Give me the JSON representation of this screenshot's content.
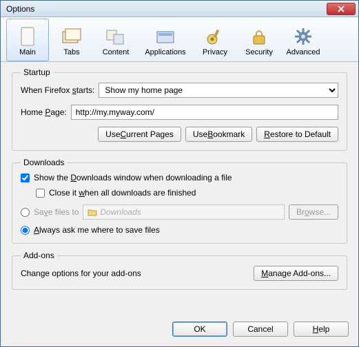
{
  "window": {
    "title": "Options"
  },
  "tabs": {
    "main": "Main",
    "tabs": "Tabs",
    "content": "Content",
    "applications": "Applications",
    "privacy": "Privacy",
    "security": "Security",
    "advanced": "Advanced"
  },
  "startup": {
    "legend": "Startup",
    "when_label_pre": "When Firefox ",
    "when_label_u": "s",
    "when_label_post": "tarts:",
    "when_value": "Show my home page",
    "home_label_pre": "Home ",
    "home_label_u": "P",
    "home_label_post": "age:",
    "home_value": "http://my.myway.com/",
    "btn_current_pre": "Use ",
    "btn_current_u": "C",
    "btn_current_post": "urrent Pages",
    "btn_bookmark_pre": "Use ",
    "btn_bookmark_u": "B",
    "btn_bookmark_post": "ookmark",
    "btn_restore_pre": "",
    "btn_restore_u": "R",
    "btn_restore_post": "estore to Default"
  },
  "downloads": {
    "legend": "Downloads",
    "show_pre": "Show the ",
    "show_u": "D",
    "show_post": "ownloads window when downloading a file",
    "close_pre": "Close it ",
    "close_u": "w",
    "close_post": "hen all downloads are finished",
    "save_pre": "Sa",
    "save_u": "v",
    "save_post": "e files to",
    "save_placeholder": "Downloads",
    "browse_pre": "Br",
    "browse_u": "o",
    "browse_post": "wse...",
    "always_pre": "",
    "always_u": "A",
    "always_post": "lways ask me where to save files"
  },
  "addons": {
    "legend": "Add-ons",
    "desc": "Change options for your add-ons",
    "btn_pre": "",
    "btn_u": "M",
    "btn_post": "anage Add-ons..."
  },
  "buttons": {
    "ok": "OK",
    "cancel": "Cancel",
    "help_u": "H",
    "help_post": "elp"
  }
}
